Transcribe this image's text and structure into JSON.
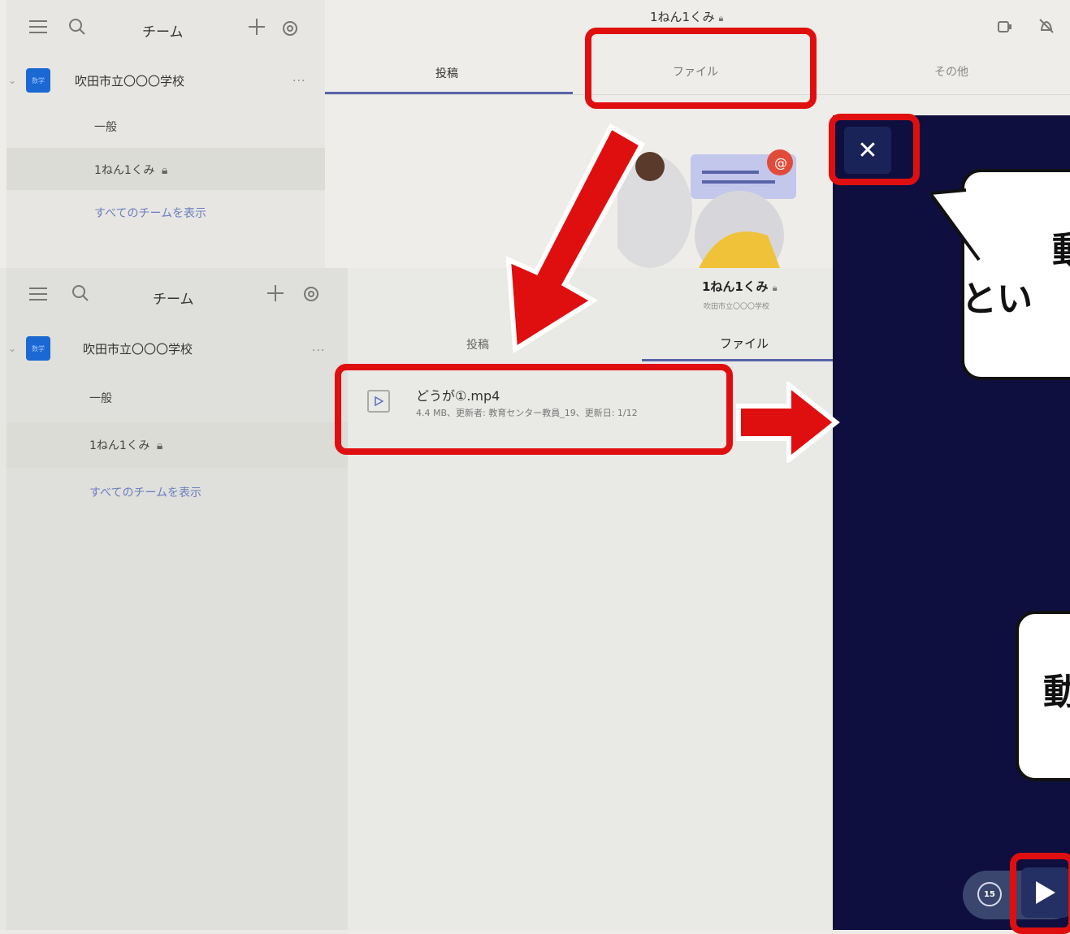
{
  "top": {
    "header_title": "1ねん1くみ",
    "team_section_title": "チーム",
    "team_name": "吹田市立〇〇〇学校",
    "avatar_text": "数学",
    "more": "...",
    "channel_general": "一般",
    "channel_class": "1ねん1くみ",
    "show_all_teams": "すべてのチームを表示",
    "tabs": [
      "投稿",
      "ファイル",
      "その他"
    ]
  },
  "bottom": {
    "header_title": "1ねん1くみ",
    "header_subtitle": "吹田市立〇〇〇学校",
    "team_section_title": "チーム",
    "team_name": "吹田市立〇〇〇学校",
    "avatar_text": "数学",
    "more": "...",
    "channel_general": "一般",
    "channel_class": "1ねん1くみ",
    "show_all_teams": "すべてのチームを表示",
    "tabs": [
      "投稿",
      "ファイル"
    ],
    "file": {
      "name": "どうが①.mp4",
      "meta": "4.4 MB、更新者: 教育センター教員_19、更新日: 1/12"
    }
  },
  "video": {
    "close_glyph": "✕",
    "bubble1_line1": "動",
    "bubble1_line2": "とい",
    "bubble2_line1": "動",
    "skip_label": "15"
  },
  "colors": {
    "annotation_red": "#e00f0f",
    "accent": "#5963a8",
    "video_bg": "#0e0f3f"
  }
}
